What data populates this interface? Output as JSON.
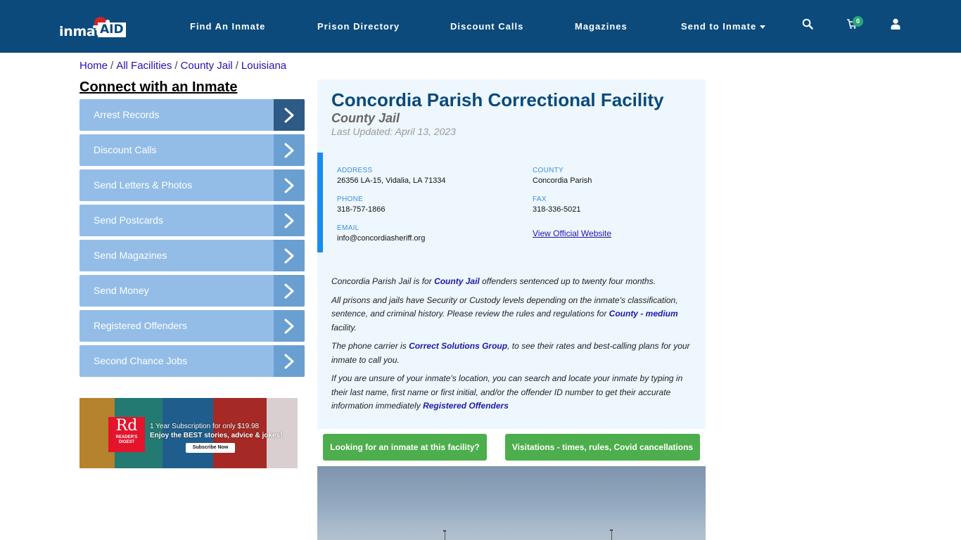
{
  "header": {
    "logo_text": "inmate",
    "logo_accent": "AID",
    "nav": [
      {
        "label": "Find An Inmate"
      },
      {
        "label": "Prison Directory"
      },
      {
        "label": "Discount Calls"
      },
      {
        "label": "Magazines"
      },
      {
        "label": "Send to Inmate"
      }
    ],
    "icons": {
      "search": "search-icon",
      "cart": "cart-icon",
      "user": "user-icon"
    },
    "cart_count": "0"
  },
  "breadcrumb": [
    {
      "label": "Home"
    },
    {
      "label": "All Facilities"
    },
    {
      "label": "County Jail"
    },
    {
      "label": "Louisiana"
    }
  ],
  "breadcrumb_sep": "/",
  "sidebar": {
    "title": "Connect with an Inmate",
    "items": [
      {
        "label": "Arrest Records"
      },
      {
        "label": "Discount Calls"
      },
      {
        "label": "Send Letters & Photos"
      },
      {
        "label": "Send Postcards"
      },
      {
        "label": "Send Magazines"
      },
      {
        "label": "Send Money"
      },
      {
        "label": "Registered Offenders"
      },
      {
        "label": "Second Chance Jobs"
      }
    ],
    "ad": {
      "brand_mark": "Rd",
      "brand_name": "READER'S DIGEST",
      "cover_text": "Reader's",
      "line1": "1 Year Subscription for only $19.98",
      "line2": "Enjoy the BEST stories, advice & jokes!",
      "button": "Subscribe Now"
    }
  },
  "facility": {
    "title": "Concordia Parish Correctional Facility",
    "type": "County Jail",
    "last_updated": "Last Updated: April 13, 2023",
    "info": {
      "address_label": "ADDRESS",
      "address": "26356 LA-15, Vidalia, LA 71334",
      "county_label": "COUNTY",
      "county": "Concordia Parish",
      "phone_label": "PHONE",
      "phone": "318-757-1866",
      "fax_label": "FAX",
      "fax": "318-336-5021",
      "email_label": "EMAIL",
      "email": "info@concordiasheriff.org",
      "website_link": "View Official Website"
    },
    "description": {
      "p1_a": "Concordia Parish Jail is for ",
      "p1_link": "County Jail",
      "p1_b": " offenders sentenced up to twenty four months.",
      "p2_a": "All prisons and jails have Security or Custody levels depending on the inmate's classification, sentence, and criminal history. Please review the rules and regulations for ",
      "p2_link": "County - medium",
      "p2_b": " facility.",
      "p3_a": "The phone carrier is ",
      "p3_link": "Correct Solutions Group",
      "p3_b": ", to see their rates and best-calling plans for your inmate to call you.",
      "p4_a": "If you are unsure of your inmate's location, you can search and locate your inmate by typing in their last name, first name or first initial, and/or the offender ID number to get their accurate information immediately ",
      "p4_link": "Registered Offenders"
    },
    "buttons": {
      "find_inmate": "Looking for an inmate at this facility?",
      "visitations": "Visitations - times, rules, Covid cancellations"
    }
  },
  "colors": {
    "header_bg": "#0b4a7b",
    "sidebar_item": "#93bde7",
    "sidebar_arrow": "#6a9fd2",
    "sidebar_arrow_active": "#2e5a86",
    "panel_bg": "#eef7fd",
    "accent_bar": "#1a8cf0",
    "green_button": "#4cae4c",
    "cart_badge": "#28a77a"
  }
}
